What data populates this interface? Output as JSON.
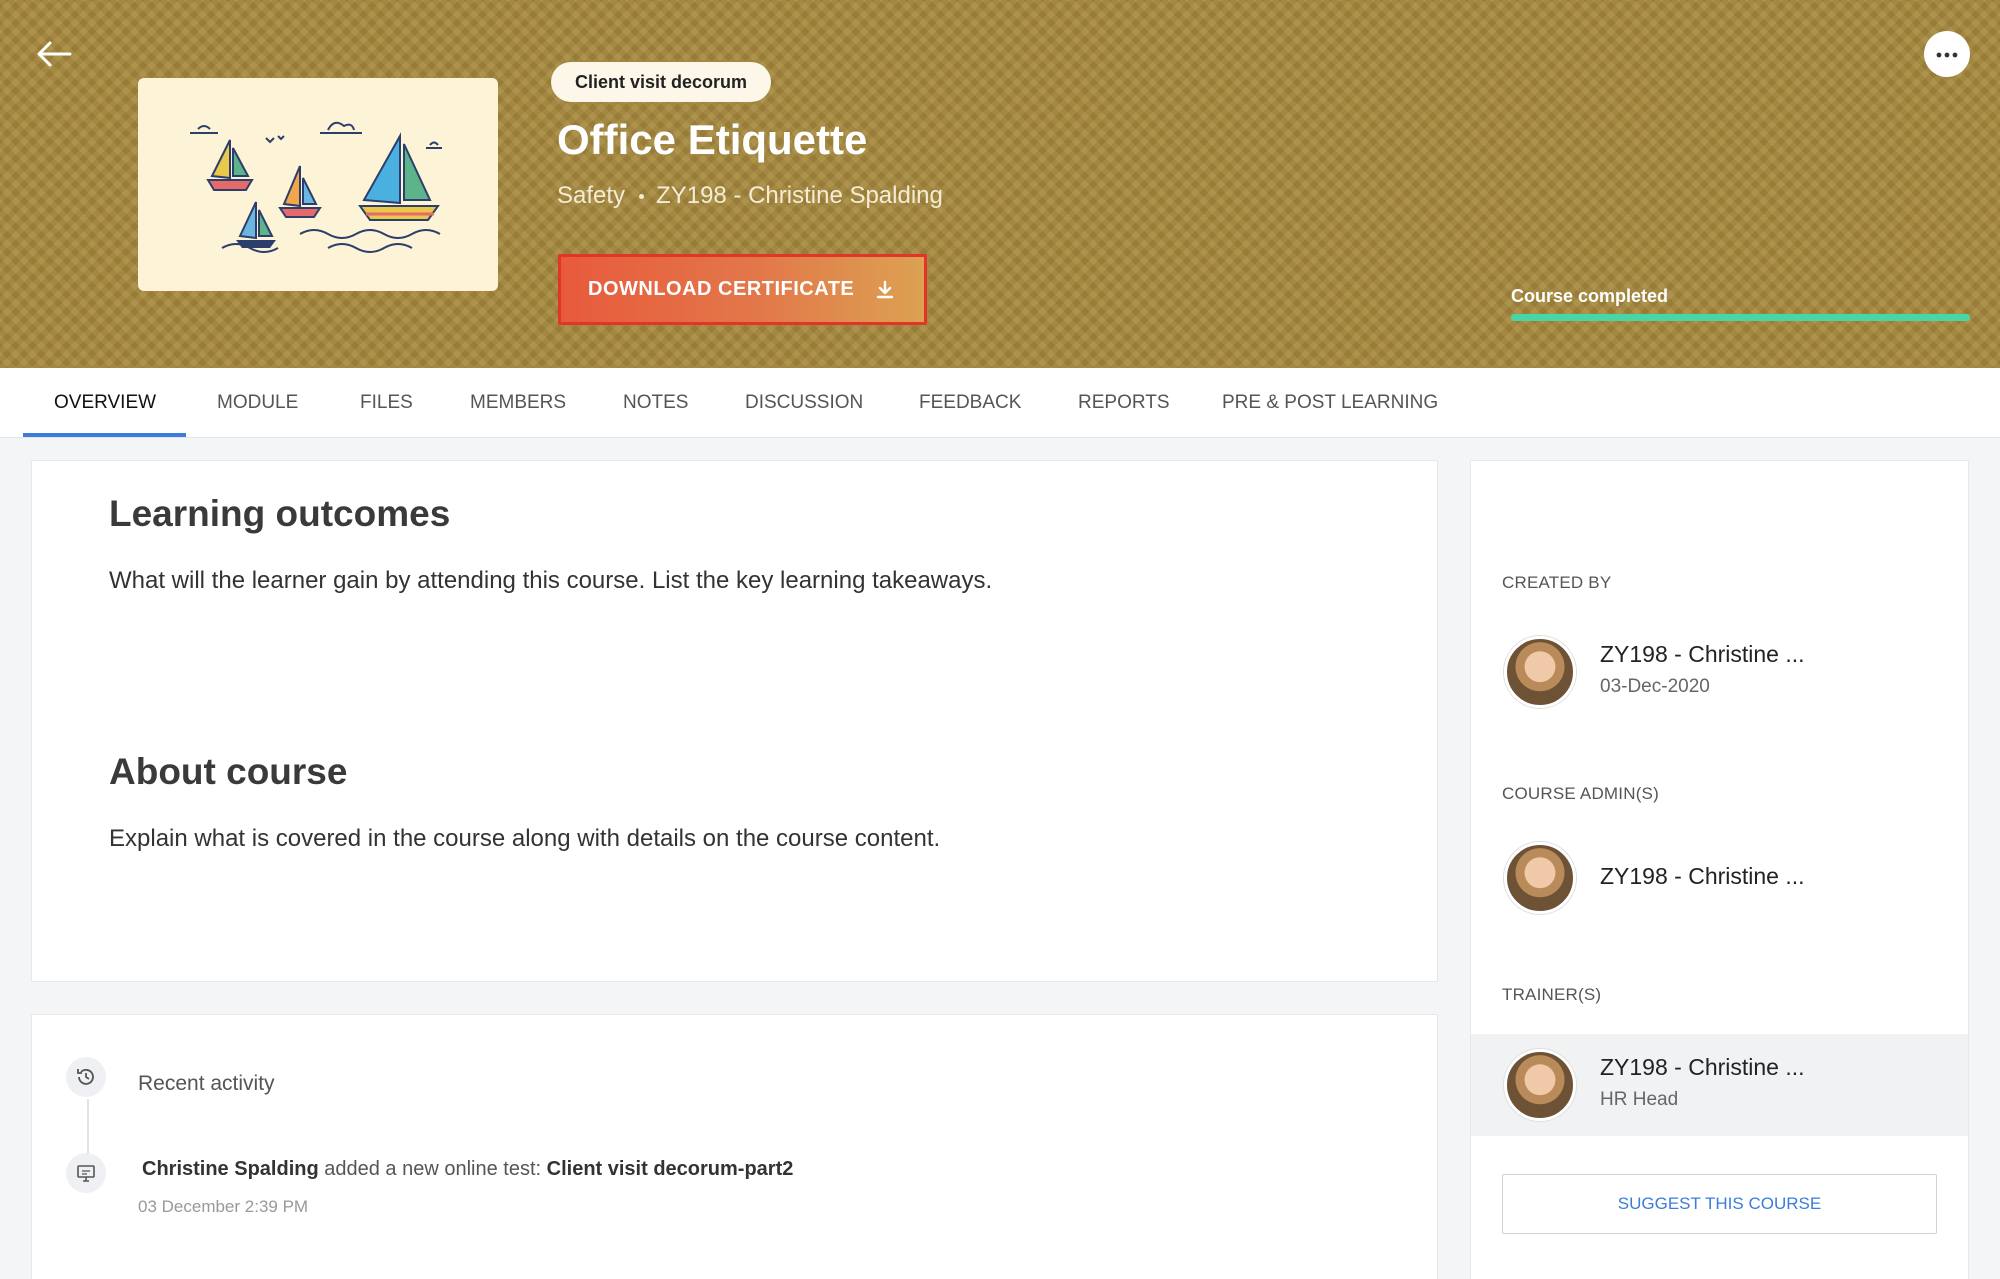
{
  "header": {
    "tag": "Client visit decorum",
    "title": "Office Etiquette",
    "category": "Safety",
    "owner": "ZY198 - Christine Spalding",
    "download_label": "DOWNLOAD CERTIFICATE",
    "progress_label": "Course completed",
    "progress_fraction": 1.0,
    "colors": {
      "banner": "#a88a3e",
      "button": "#e2784a",
      "progress": "#48d6a5"
    }
  },
  "tabs": [
    "OVERVIEW",
    "MODULE",
    "FILES",
    "MEMBERS",
    "NOTES",
    "DISCUSSION",
    "FEEDBACK",
    "REPORTS",
    "PRE & POST LEARNING"
  ],
  "active_tab": "OVERVIEW",
  "overview": {
    "outcomes_heading": "Learning outcomes",
    "outcomes_text": "What will the learner gain by attending this course. List the key learning takeaways.",
    "about_heading": "About course",
    "about_text": "Explain what is covered in the course along with details on the course content."
  },
  "activity": {
    "title": "Recent activity",
    "items": [
      {
        "actor": "Christine Spalding",
        "action": "added a new online test:",
        "target": "Client visit decorum-part2",
        "time": "03 December 2:39 PM"
      }
    ]
  },
  "sidebar": {
    "created_by_label": "CREATED BY",
    "creator_name": "ZY198 - Christine ...",
    "creator_date": "03-Dec-2020",
    "admins_label": "COURSE ADMIN(S)",
    "admin_name": "ZY198 - Christine ...",
    "trainers_label": "TRAINER(S)",
    "trainer_name": "ZY198 - Christine ...",
    "trainer_role": "HR Head",
    "suggest_label": "SUGGEST THIS COURSE"
  }
}
